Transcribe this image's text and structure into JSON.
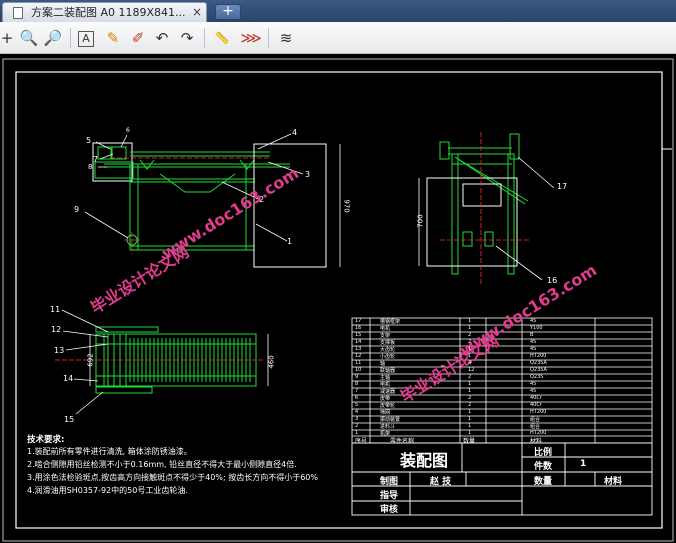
{
  "window": {
    "tab_title": "方案二装配图 A0 1189X841...",
    "close_glyph": "×",
    "new_tab_glyph": "+"
  },
  "toolbar": {
    "tools": [
      {
        "name": "zoom-in-icon",
        "glyph": "+"
      },
      {
        "name": "zoom-icon",
        "glyph": "🔍"
      },
      {
        "name": "zoom-fit-icon",
        "glyph": "🔎"
      },
      {
        "name": "text-tool-icon",
        "glyph": "A"
      },
      {
        "name": "pencil-icon",
        "glyph": "✎"
      },
      {
        "name": "marker-icon",
        "glyph": "✐"
      },
      {
        "name": "undo-icon",
        "glyph": "↶"
      },
      {
        "name": "redo-icon",
        "glyph": "↷"
      },
      {
        "name": "measure-icon",
        "glyph": "📏"
      },
      {
        "name": "arrow-markup-icon",
        "glyph": "⋙"
      },
      {
        "name": "layers-icon",
        "glyph": "≋"
      }
    ]
  },
  "drawing": {
    "part_labels": [
      {
        "id": "p1",
        "text": "1"
      },
      {
        "id": "p2",
        "text": "2"
      },
      {
        "id": "p3",
        "text": "3"
      },
      {
        "id": "p4",
        "text": "4"
      },
      {
        "id": "p5",
        "text": "5"
      },
      {
        "id": "p6",
        "text": "6"
      },
      {
        "id": "p7",
        "text": "7"
      },
      {
        "id": "p8",
        "text": "8"
      },
      {
        "id": "p9",
        "text": "9"
      },
      {
        "id": "p11",
        "text": "11"
      },
      {
        "id": "p12",
        "text": "12"
      },
      {
        "id": "p13",
        "text": "13"
      },
      {
        "id": "p14",
        "text": "14"
      },
      {
        "id": "p15",
        "text": "15"
      },
      {
        "id": "p16",
        "text": "16"
      },
      {
        "id": "p17",
        "text": "17"
      }
    ],
    "dimensions": {
      "d1": "970",
      "d2": "700",
      "d3": "692",
      "d4": "460"
    },
    "watermark": "www.doc163.com",
    "watermark_cn": "毕业设计论文网",
    "tech_title": "技术要求:",
    "tech_lines": [
      "1.装配前所有零件进行清洗, 箱体涂防锈油漆。",
      "2.啮合侧隙用铅丝检测不小于0.16mm, 铅丝直径不得大于最小侧隙直径4倍.",
      "3.用涂色法检验斑点,按齿高方向接触斑点不得少于40%; 按齿长方向不得小于60%",
      "4.润滑油用SH0357-92中的50号工业齿轮油."
    ]
  },
  "bom": {
    "rows": [
      {
        "no": "17",
        "name": "槽钢框架",
        "qty": "1",
        "mat": "45"
      },
      {
        "no": "16",
        "name": "电机",
        "qty": "1",
        "mat": "Y100"
      },
      {
        "no": "15",
        "name": "支架",
        "qty": "2",
        "mat": "B"
      },
      {
        "no": "14",
        "name": "支撑板",
        "qty": "2",
        "mat": "45"
      },
      {
        "no": "13",
        "name": "大齿轮",
        "qty": "1",
        "mat": "45"
      },
      {
        "no": "12",
        "name": "小齿轮",
        "qty": "1",
        "mat": "HT200"
      },
      {
        "no": "11",
        "name": "轴",
        "qty": "4",
        "mat": "Q235A"
      },
      {
        "no": "10",
        "name": "联轴器",
        "qty": "12",
        "mat": "Q235A"
      },
      {
        "no": "9",
        "name": "主轴",
        "qty": "2",
        "mat": "Q235"
      },
      {
        "no": "8",
        "name": "电机",
        "qty": "1",
        "mat": "45"
      },
      {
        "no": "7",
        "name": "减速器",
        "qty": "1",
        "mat": "45"
      },
      {
        "no": "6",
        "name": "皮带",
        "qty": "2",
        "mat": "40Cr"
      },
      {
        "no": "5",
        "name": "皮带轮",
        "qty": "2",
        "mat": "40Cr"
      },
      {
        "no": "4",
        "name": "筛网",
        "qty": "1",
        "mat": "HT200"
      },
      {
        "no": "3",
        "name": "振动装置",
        "qty": "1",
        "mat": "组合"
      },
      {
        "no": "2",
        "name": "进料斗",
        "qty": "1",
        "mat": "组合"
      },
      {
        "no": "1",
        "name": "机架",
        "qty": "1",
        "mat": "HT200"
      }
    ],
    "header": {
      "no": "序号",
      "name": "零件名称",
      "qty": "数量",
      "mat": "材料"
    }
  },
  "title_block": {
    "title": "装配图",
    "scale_label": "比例",
    "parts_label": "件数",
    "parts_value": "1",
    "qty_label": "数量",
    "material_label": "材料",
    "drawn_label": "制图",
    "drawn_name": "赵 技",
    "guide_label": "指导",
    "review_label": "审核"
  },
  "colors": {
    "bg": "#000000",
    "line": "#ffffff",
    "green": "#1fdd3a",
    "red": "#ff3030",
    "watermark": "#e23b8e"
  }
}
